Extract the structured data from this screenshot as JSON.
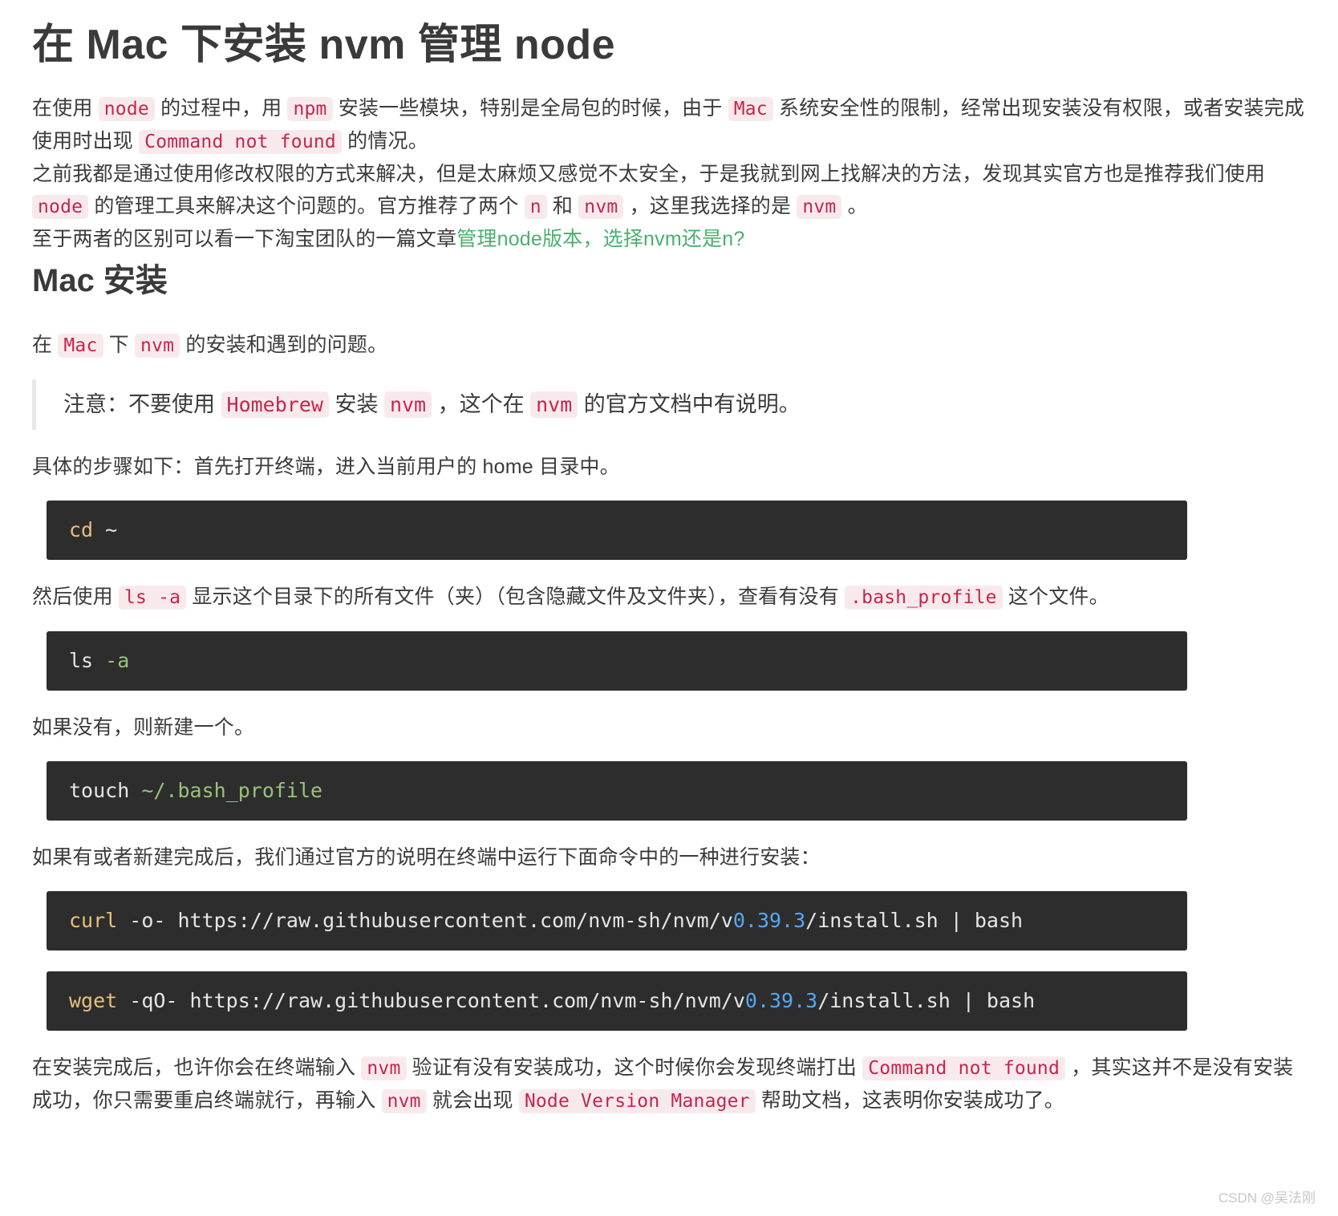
{
  "document": {
    "title": "在 Mac 下安装 nvm 管理 node",
    "section_title": "Mac 安装",
    "watermark": "CSDN @吴法刚"
  },
  "intro": {
    "p1_seg1": "在使用 ",
    "p1_code1": "node",
    "p1_seg2": " 的过程中，用 ",
    "p1_code2": "npm",
    "p1_seg3": " 安装一些模块，特别是全局包的时候，由于 ",
    "p1_code3": "Mac",
    "p1_seg4": " 系统安全性的限制，经常出现安装没有权限，或者安装完成使用时出现 ",
    "p1_code4": "Command not found",
    "p1_seg5": " 的情况。",
    "p2_seg1": "之前我都是通过使用修改权限的方式来解决，但是太麻烦又感觉不太安全，于是我就到网上找解决的方法，发现其实官方也是推荐我们使用 ",
    "p2_code1": "node",
    "p2_seg2": " 的管理工具来解决这个问题的。官方推荐了两个 ",
    "p2_code2": "n",
    "p2_seg3": " 和 ",
    "p2_code3": "nvm",
    "p2_seg4": " ，这里我选择的是 ",
    "p2_code4": "nvm",
    "p2_seg5": " 。",
    "p3_seg1": "至于两者的区别可以看一下淘宝团队的一篇文章",
    "p3_link": "管理node版本，选择nvm还是n?"
  },
  "mac_install": {
    "lead_seg1": "在 ",
    "lead_code1": "Mac",
    "lead_seg2": " 下 ",
    "lead_code2": "nvm",
    "lead_seg3": " 的安装和遇到的问题。",
    "note_seg1": "注意：不要使用 ",
    "note_code1": "Homebrew",
    "note_seg2": " 安装 ",
    "note_code2": "nvm",
    "note_seg3": " ，这个在 ",
    "note_code3": "nvm",
    "note_seg4": " 的官方文档中有说明。",
    "step1_text": "具体的步骤如下：首先打开终端，进入当前用户的 home 目录中。",
    "code1_cmd": "cd",
    "code1_arg": " ~",
    "step2_seg1": "然后使用 ",
    "step2_code1": "ls -a",
    "step2_seg2": " 显示这个目录下的所有文件（夹）（包含隐藏文件及文件夹），查看有没有 ",
    "step2_code2": ".bash_profile",
    "step2_seg3": " 这个文件。",
    "code2_cmd": "ls",
    "code2_arg": " -a",
    "step3_text": "如果没有，则新建一个。",
    "code3_cmd": "touch",
    "code3_arg": " ~/.bash_profile",
    "step4_text": "如果有或者新建完成后，我们通过官方的说明在终端中运行下面命令中的一种进行安装：",
    "code4_cmd": "curl",
    "code4_part1": " -o- https://raw.githubusercontent.com/nvm-sh/nvm/v",
    "code4_num": "0.39.3",
    "code4_part2": "/install.sh | bash",
    "code5_cmd": "wget",
    "code5_part1": " -qO- https://raw.githubusercontent.com/nvm-sh/nvm/v",
    "code5_num": "0.39.3",
    "code5_part2": "/install.sh | bash",
    "final_seg1": "在安装完成后，也许你会在终端输入 ",
    "final_code1": "nvm",
    "final_seg2": " 验证有没有安装成功，这个时候你会发现终端打出 ",
    "final_code2": "Command not found",
    "final_seg3": " ，其实这并不是没有安装成功，你只需要重启终端就行，再输入 ",
    "final_code3": "nvm",
    "final_seg4": " 就会出现 ",
    "final_code4": "Node Version Manager",
    "final_seg5": " 帮助文档，这表明你安装成功了。"
  },
  "colors": {
    "inline_code_bg": "#f8eaec",
    "inline_code_fg": "#c7254e",
    "code_block_bg": "#2d2d2d",
    "link": "#4caf6d",
    "command_token": "#e6c07b",
    "string_token": "#98c379",
    "number_token": "#56a8f5"
  }
}
